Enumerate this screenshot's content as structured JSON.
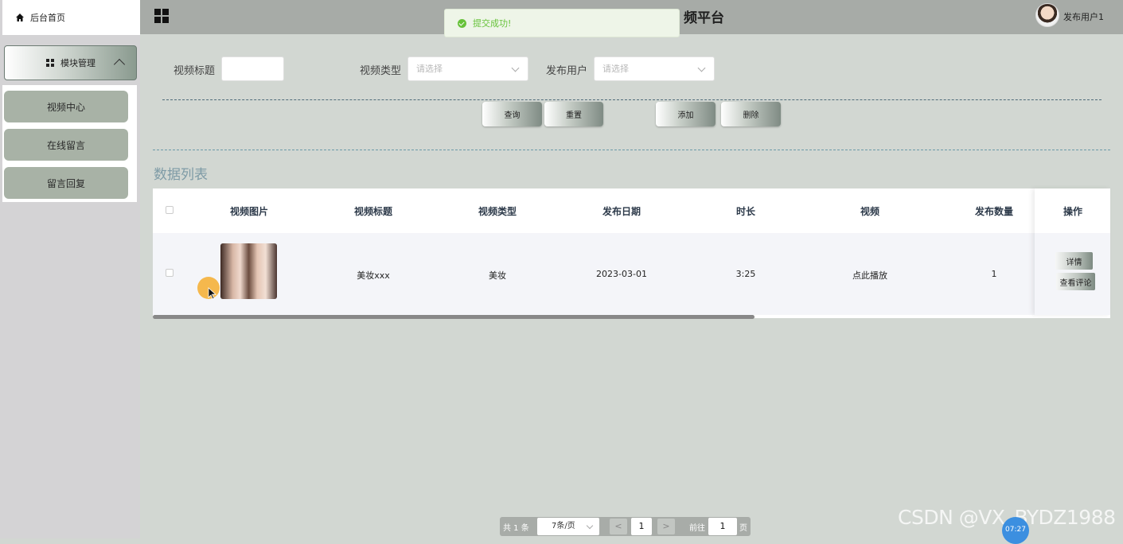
{
  "sidebar": {
    "home_label": "后台首页",
    "module_label": "模块管理",
    "items": [
      {
        "label": "视频中心"
      },
      {
        "label": "在线留言"
      },
      {
        "label": "留言回复"
      }
    ]
  },
  "header": {
    "title": "频平台",
    "username": "发布用户1"
  },
  "toast": {
    "message": "提交成功!"
  },
  "search": {
    "title_label": "视频标题",
    "title_value": "",
    "type_label": "视频类型",
    "type_placeholder": "请选择",
    "user_label": "发布用户",
    "user_placeholder": "请选择"
  },
  "actions": {
    "query": "查询",
    "reset": "重置",
    "add": "添加",
    "delete": "删除"
  },
  "list_title": "数据列表",
  "table": {
    "columns": [
      "视频图片",
      "视频标题",
      "视频类型",
      "发布日期",
      "时长",
      "视频",
      "发布数量",
      "操作"
    ],
    "rows": [
      {
        "title": "美妆xxx",
        "type": "美妆",
        "date": "2023-03-01",
        "duration": "3:25",
        "video": "点此播放",
        "count": "1",
        "op_detail": "详情",
        "op_comments": "查看评论"
      }
    ]
  },
  "pagination": {
    "total": "共 1 条",
    "page_size": "7条/页",
    "prev": "<",
    "current_page": "1",
    "next": ">",
    "goto_label": "前往",
    "goto_value": "1",
    "page_suffix": "页"
  },
  "watermark": "CSDN @VX_BYDZ1988",
  "timer": "07:27",
  "colors": {
    "header_bg": "#a7aba7",
    "content_bg": "#d2d7d2",
    "sidebar_item_bg": "#a8b2a6",
    "toast_success": "#67c23a",
    "list_title": "#7e9ba6"
  }
}
